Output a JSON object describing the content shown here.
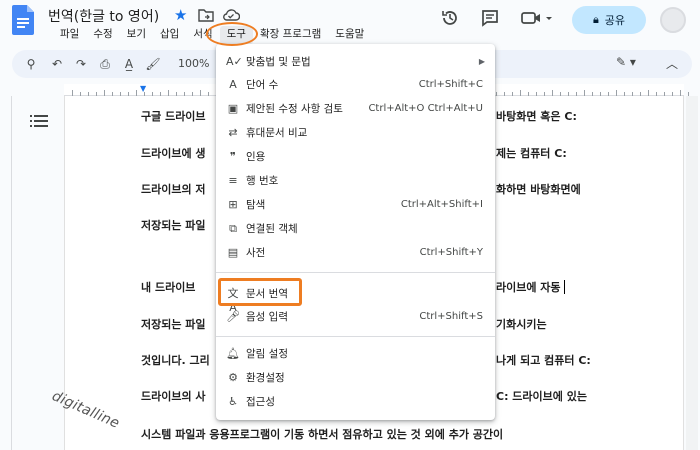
{
  "header": {
    "doc_title": "번역(한글 to 영어)",
    "share_label": "공유"
  },
  "menu": {
    "items": [
      "파일",
      "수정",
      "보기",
      "삽입",
      "서식",
      "도구",
      "확장 프로그램",
      "도움말"
    ],
    "active_index": 5
  },
  "toolbar": {
    "zoom": "100%"
  },
  "document": {
    "lines": [
      "구글 드라이브",
      "드라이브에 생",
      "드라이브의 저",
      "저장되는 파일",
      "내 드라이브",
      "저장되는 파일",
      "것입니다. 그리",
      "드라이브의 사",
      "시스템 파일과 응용프로그램이 기동 하면서 점유하고 있는 것 외에 추가 공간이"
    ],
    "right_fragments": [
      "바탕화면 혹은 C:",
      "제는 컴퓨터 C:",
      "화하면 바탕화면에",
      "",
      "라이브에 자동",
      "기화시키는",
      "나게 되고 컴퓨터 C:",
      "C: 드라이브에 있는",
      ""
    ]
  },
  "watermark": "digitalline",
  "tools_menu": {
    "items": [
      {
        "icon": "spellcheck-icon",
        "label": "맞춤법 및 문법",
        "shortcut": "",
        "submenu": true
      },
      {
        "icon": "word-count-icon",
        "label": "단어 수",
        "shortcut": "Ctrl+Shift+C"
      },
      {
        "icon": "review-suggested-edits-icon",
        "label": "제안된 수정 사항 검토",
        "shortcut": "Ctrl+Alt+O Ctrl+Alt+U"
      },
      {
        "icon": "compare-documents-icon",
        "label": "휴대문서 비교",
        "shortcut": ""
      },
      {
        "icon": "citations-icon",
        "label": "인용",
        "shortcut": ""
      },
      {
        "icon": "line-numbers-icon",
        "label": "행 번호",
        "shortcut": ""
      },
      {
        "icon": "explore-icon",
        "label": "탐색",
        "shortcut": "Ctrl+Alt+Shift+I"
      },
      {
        "icon": "linked-objects-icon",
        "label": "연결된 객체",
        "shortcut": ""
      },
      {
        "icon": "dictionary-icon",
        "label": "사전",
        "shortcut": "Ctrl+Shift+Y"
      },
      {
        "icon": "translate-icon",
        "label": "문서 번역",
        "shortcut": ""
      },
      {
        "icon": "microphone-icon",
        "label": "음성 입력",
        "shortcut": "Ctrl+Shift+S"
      },
      {
        "icon": "bell-icon",
        "label": "알림 설정",
        "shortcut": ""
      },
      {
        "icon": "preferences-icon",
        "label": "환경설정",
        "shortcut": ""
      },
      {
        "icon": "accessibility-icon",
        "label": "접근성",
        "shortcut": ""
      }
    ]
  },
  "colors": {
    "accent": "#1a73e8",
    "share_bg": "#c2e7ff",
    "highlight": "#ee7d22"
  }
}
